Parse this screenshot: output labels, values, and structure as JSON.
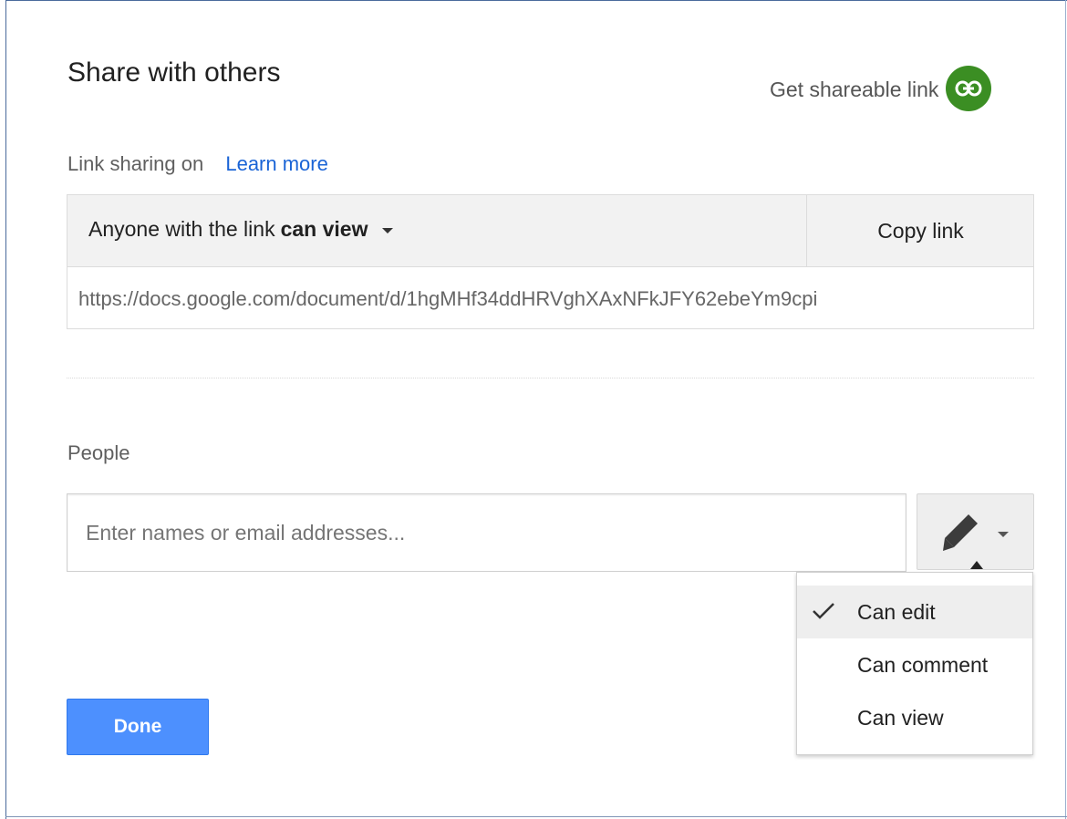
{
  "dialog": {
    "title": "Share with others",
    "shareable_link_label": "Get shareable link",
    "icons": {
      "link": "link-icon",
      "edit": "pencil-icon",
      "dropdown": "caret-down-icon",
      "check": "check-icon"
    },
    "colors": {
      "link_icon_bg": "#3b8e23",
      "learn_more": "#1a64d6",
      "done_button": "#4d90fe"
    }
  },
  "link_sharing": {
    "status": "Link sharing on",
    "learn_more": "Learn more",
    "access_prefix": "Anyone with the link",
    "access_level": "can view",
    "copy_link": "Copy link",
    "url": "https://docs.google.com/document/d/1hgMHf34ddHRVghXAxNFkJFY62ebeYm9cpi"
  },
  "people": {
    "label": "People",
    "placeholder": "Enter names or email addresses...",
    "permission_menu": {
      "items": [
        {
          "label": "Can edit",
          "selected": true
        },
        {
          "label": "Can comment",
          "selected": false
        },
        {
          "label": "Can view",
          "selected": false
        }
      ]
    }
  },
  "footer": {
    "done": "Done"
  }
}
